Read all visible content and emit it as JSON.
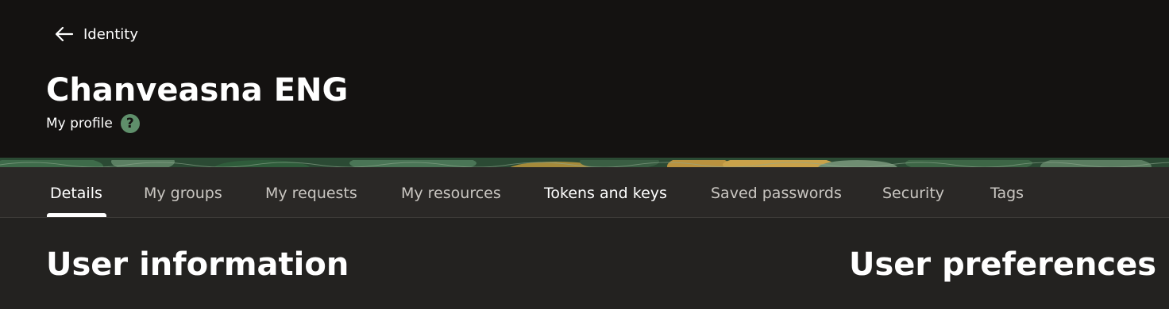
{
  "header": {
    "back_label": "Identity",
    "title": "Chanveasna ENG",
    "subtitle": "My profile",
    "help_glyph": "?",
    "help_icon_color": "#5f8f6b",
    "background_color": "#141211"
  },
  "tabs": [
    {
      "label": "Details",
      "active": true
    },
    {
      "label": "My groups",
      "active": false
    },
    {
      "label": "My requests",
      "active": false
    },
    {
      "label": "My resources",
      "active": false
    },
    {
      "label": "Tokens and keys",
      "active": false
    },
    {
      "label": "Saved passwords",
      "active": false
    },
    {
      "label": "Security",
      "active": false
    },
    {
      "label": "Tags",
      "active": false
    }
  ],
  "main": {
    "user_information_title": "User information",
    "user_preferences_title": "User preferences"
  },
  "icons": {
    "back": "arrow-left-icon",
    "help": "question-circle-icon"
  }
}
